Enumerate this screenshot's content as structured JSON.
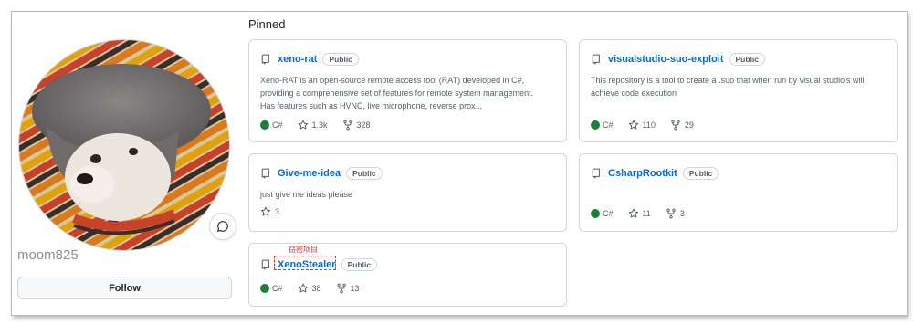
{
  "profile": {
    "username": "moom825",
    "follow_label": "Follow",
    "status_icon": "smiley-status-icon"
  },
  "pinned": {
    "title": "Pinned",
    "lang_color": "#1a7f37",
    "repos": [
      {
        "name": "xeno-rat",
        "visibility": "Public",
        "description_lines": [
          "Xeno-RAT is an open-source remote access tool (RAT) developed in C#,",
          "providing a comprehensive set of features for remote system management.",
          "Has features such as HVNC, live microphone, reverse prox..."
        ],
        "language": "C#",
        "stars": "1.3k",
        "forks": "328"
      },
      {
        "name": "visualstudio-suo-exploit",
        "visibility": "Public",
        "description_lines": [
          "This repository is a tool to create a .suo that when run by visual studio's will",
          "achieve code execution"
        ],
        "language": "C#",
        "stars": "110",
        "forks": "29"
      },
      {
        "name": "Give-me-idea",
        "visibility": "Public",
        "description_lines": [
          "just give me ideas please"
        ],
        "stars": "3"
      },
      {
        "name": "CsharpRootkit",
        "visibility": "Public",
        "language": "C#",
        "stars": "11",
        "forks": "3"
      },
      {
        "name": "XenoStealer",
        "visibility": "Public",
        "language": "C#",
        "stars": "38",
        "forks": "13"
      }
    ]
  },
  "annotation": {
    "label": "窃密项目",
    "color": "#e0302f"
  }
}
